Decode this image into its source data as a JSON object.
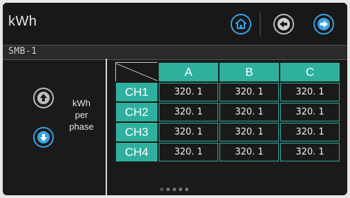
{
  "header": {
    "title": "kWh"
  },
  "subheader": {
    "label": "SMB-1"
  },
  "side": {
    "label_line1": "kWh",
    "label_line2": "per",
    "label_line3": "phase"
  },
  "table": {
    "columns": [
      "A",
      "B",
      "C"
    ],
    "rows": [
      {
        "label": "CH1",
        "values": [
          "320. 1",
          "320. 1",
          "320. 1"
        ]
      },
      {
        "label": "CH2",
        "values": [
          "320. 1",
          "320. 1",
          "320. 1"
        ]
      },
      {
        "label": "CH3",
        "values": [
          "320. 1",
          "320. 1",
          "320. 1"
        ]
      },
      {
        "label": "CH4",
        "values": [
          "320. 1",
          "320. 1",
          "320. 1"
        ]
      }
    ]
  },
  "pager": {
    "page_count": 5,
    "current_page": 1
  },
  "colors": {
    "accent_teal": "#2fb09e",
    "accent_blue": "#39a3e8",
    "background": "#1a1a1a"
  },
  "icons": {
    "home": "home-icon",
    "back": "arrow-left-icon",
    "forward": "arrow-right-icon",
    "up": "arrow-up-icon",
    "down": "arrow-down-icon"
  }
}
